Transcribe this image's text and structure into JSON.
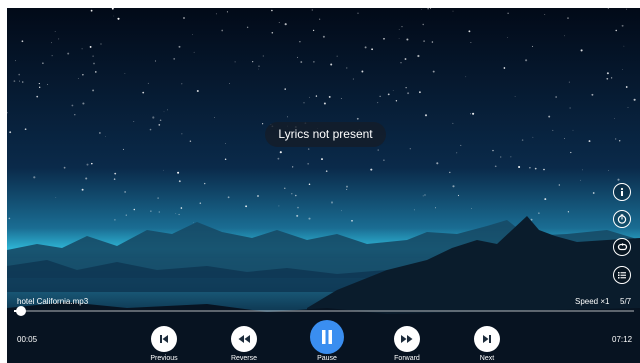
{
  "lyrics_message": "Lyrics not present",
  "track": {
    "filename": "hotel California.mp3",
    "elapsed": "00:05",
    "duration": "07:12",
    "progress": 0.012
  },
  "playback": {
    "speed_label": "Speed ×1",
    "queue_position": "5/7"
  },
  "side_icons": [
    "info-icon",
    "timer-icon",
    "repeat-icon",
    "playlist-icon"
  ],
  "controls": [
    {
      "name": "previous",
      "label": "Previous",
      "icon": "skip-previous-icon"
    },
    {
      "name": "reverse",
      "label": "Reverse",
      "icon": "rewind-icon"
    },
    {
      "name": "pause",
      "label": "Pause",
      "icon": "pause-icon"
    },
    {
      "name": "forward",
      "label": "Forward",
      "icon": "fast-forward-icon"
    },
    {
      "name": "next",
      "label": "Next",
      "icon": "skip-next-icon"
    }
  ],
  "colors": {
    "accent": "#3a8ef0",
    "sky_top": "#020a18",
    "horizon_glow": "#2fb6d6"
  }
}
